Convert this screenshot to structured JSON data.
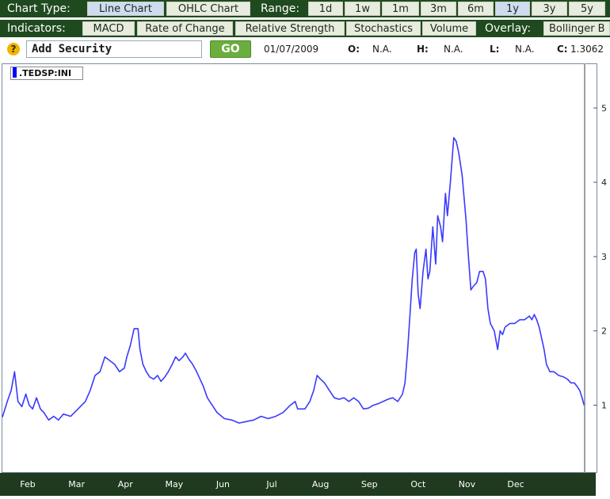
{
  "toolbar": {
    "chart_type_label": "Chart Type:",
    "chart_types": [
      "Line Chart",
      "OHLC Chart"
    ],
    "range_label": "Range:",
    "ranges": [
      "1d",
      "1w",
      "1m",
      "3m",
      "6m",
      "1y",
      "3y",
      "5y"
    ],
    "active_range": "1y"
  },
  "indicators": {
    "label": "Indicators:",
    "items": [
      "MACD",
      "Rate of Change",
      "Relative Strength",
      "Stochastics",
      "Volume"
    ],
    "overlay_label": "Overlay:",
    "overlay_item": "Bollinger B"
  },
  "quote": {
    "help": "?",
    "add_security": "Add Security",
    "go": "GO",
    "date": "01/07/2009",
    "o_label": "O:",
    "o_value": "N.A.",
    "h_label": "H:",
    "h_value": "N.A.",
    "l_label": "L:",
    "l_value": "N.A.",
    "c_label": "C:",
    "c_value": "1.3062"
  },
  "chart_data": {
    "type": "line",
    "legend": ".TEDSP:INI",
    "line_color": "#3a3aff",
    "x_months": [
      "Feb",
      "Mar",
      "Apr",
      "May",
      "Jun",
      "Jul",
      "Aug",
      "Sep",
      "Oct",
      "Nov",
      "Dec"
    ],
    "y_ticks": [
      1,
      2,
      3,
      4,
      5
    ],
    "ylim": [
      0.1,
      5.6
    ],
    "series": [
      {
        "name": ".TEDSP:INI",
        "points": [
          [
            0.0,
            0.84
          ],
          [
            0.1,
            1.05
          ],
          [
            0.18,
            1.2
          ],
          [
            0.25,
            1.45
          ],
          [
            0.32,
            1.05
          ],
          [
            0.4,
            0.98
          ],
          [
            0.48,
            1.15
          ],
          [
            0.55,
            1.0
          ],
          [
            0.62,
            0.95
          ],
          [
            0.7,
            1.1
          ],
          [
            0.78,
            0.95
          ],
          [
            0.85,
            0.9
          ],
          [
            0.95,
            0.8
          ],
          [
            1.05,
            0.85
          ],
          [
            1.15,
            0.8
          ],
          [
            1.25,
            0.88
          ],
          [
            1.4,
            0.85
          ],
          [
            1.55,
            0.95
          ],
          [
            1.7,
            1.05
          ],
          [
            1.8,
            1.2
          ],
          [
            1.9,
            1.4
          ],
          [
            2.0,
            1.45
          ],
          [
            2.1,
            1.65
          ],
          [
            2.2,
            1.6
          ],
          [
            2.3,
            1.55
          ],
          [
            2.4,
            1.45
          ],
          [
            2.5,
            1.5
          ],
          [
            2.55,
            1.65
          ],
          [
            2.62,
            1.8
          ],
          [
            2.7,
            2.03
          ],
          [
            2.78,
            2.03
          ],
          [
            2.82,
            1.75
          ],
          [
            2.88,
            1.55
          ],
          [
            2.95,
            1.45
          ],
          [
            3.02,
            1.38
          ],
          [
            3.1,
            1.35
          ],
          [
            3.18,
            1.4
          ],
          [
            3.25,
            1.32
          ],
          [
            3.33,
            1.38
          ],
          [
            3.4,
            1.45
          ],
          [
            3.48,
            1.55
          ],
          [
            3.55,
            1.65
          ],
          [
            3.62,
            1.6
          ],
          [
            3.7,
            1.65
          ],
          [
            3.75,
            1.7
          ],
          [
            3.82,
            1.62
          ],
          [
            3.9,
            1.55
          ],
          [
            3.98,
            1.45
          ],
          [
            4.05,
            1.35
          ],
          [
            4.12,
            1.25
          ],
          [
            4.2,
            1.1
          ],
          [
            4.3,
            1.0
          ],
          [
            4.4,
            0.9
          ],
          [
            4.55,
            0.82
          ],
          [
            4.7,
            0.8
          ],
          [
            4.85,
            0.76
          ],
          [
            5.0,
            0.78
          ],
          [
            5.15,
            0.8
          ],
          [
            5.3,
            0.85
          ],
          [
            5.45,
            0.82
          ],
          [
            5.6,
            0.85
          ],
          [
            5.75,
            0.9
          ],
          [
            5.9,
            1.0
          ],
          [
            6.0,
            1.05
          ],
          [
            6.05,
            0.95
          ],
          [
            6.2,
            0.95
          ],
          [
            6.3,
            1.05
          ],
          [
            6.38,
            1.2
          ],
          [
            6.45,
            1.4
          ],
          [
            6.52,
            1.35
          ],
          [
            6.6,
            1.3
          ],
          [
            6.7,
            1.2
          ],
          [
            6.8,
            1.1
          ],
          [
            6.9,
            1.08
          ],
          [
            7.0,
            1.1
          ],
          [
            7.1,
            1.05
          ],
          [
            7.2,
            1.1
          ],
          [
            7.3,
            1.05
          ],
          [
            7.4,
            0.95
          ],
          [
            7.5,
            0.96
          ],
          [
            7.6,
            1.0
          ],
          [
            7.7,
            1.02
          ],
          [
            7.8,
            1.05
          ],
          [
            7.9,
            1.08
          ],
          [
            8.0,
            1.1
          ],
          [
            8.1,
            1.05
          ],
          [
            8.2,
            1.15
          ],
          [
            8.25,
            1.3
          ],
          [
            8.3,
            1.7
          ],
          [
            8.35,
            2.2
          ],
          [
            8.4,
            2.7
          ],
          [
            8.45,
            3.05
          ],
          [
            8.48,
            3.1
          ],
          [
            8.52,
            2.5
          ],
          [
            8.56,
            2.3
          ],
          [
            8.62,
            2.8
          ],
          [
            8.68,
            3.1
          ],
          [
            8.72,
            2.7
          ],
          [
            8.76,
            2.8
          ],
          [
            8.82,
            3.4
          ],
          [
            8.88,
            2.9
          ],
          [
            8.92,
            3.55
          ],
          [
            8.98,
            3.4
          ],
          [
            9.02,
            3.2
          ],
          [
            9.08,
            3.85
          ],
          [
            9.12,
            3.55
          ],
          [
            9.18,
            4.0
          ],
          [
            9.25,
            4.6
          ],
          [
            9.3,
            4.55
          ],
          [
            9.35,
            4.4
          ],
          [
            9.42,
            4.1
          ],
          [
            9.5,
            3.5
          ],
          [
            9.55,
            3.0
          ],
          [
            9.6,
            2.55
          ],
          [
            9.65,
            2.6
          ],
          [
            9.72,
            2.65
          ],
          [
            9.78,
            2.8
          ],
          [
            9.85,
            2.8
          ],
          [
            9.9,
            2.7
          ],
          [
            9.95,
            2.3
          ],
          [
            10.0,
            2.1
          ],
          [
            10.08,
            2.0
          ],
          [
            10.15,
            1.75
          ],
          [
            10.2,
            2.0
          ],
          [
            10.25,
            1.95
          ],
          [
            10.3,
            2.05
          ],
          [
            10.4,
            2.1
          ],
          [
            10.5,
            2.1
          ],
          [
            10.6,
            2.15
          ],
          [
            10.7,
            2.15
          ],
          [
            10.8,
            2.2
          ],
          [
            10.85,
            2.15
          ],
          [
            10.9,
            2.22
          ],
          [
            10.95,
            2.15
          ],
          [
            11.0,
            2.05
          ],
          [
            11.05,
            1.9
          ],
          [
            11.1,
            1.75
          ],
          [
            11.15,
            1.55
          ],
          [
            11.22,
            1.45
          ],
          [
            11.3,
            1.45
          ],
          [
            11.4,
            1.4
          ],
          [
            11.5,
            1.38
          ],
          [
            11.58,
            1.35
          ],
          [
            11.65,
            1.3
          ],
          [
            11.72,
            1.3
          ],
          [
            11.78,
            1.25
          ],
          [
            11.83,
            1.2
          ],
          [
            11.88,
            1.1
          ],
          [
            11.92,
            1.0
          ]
        ]
      }
    ]
  }
}
